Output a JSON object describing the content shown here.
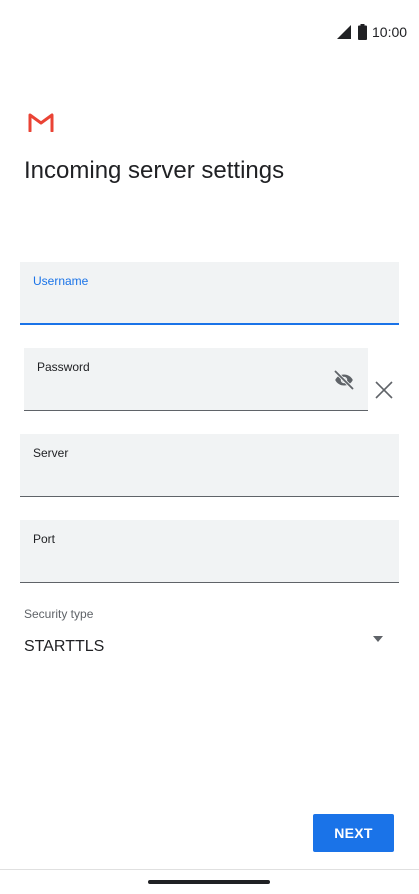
{
  "status_bar": {
    "time": "10:00",
    "signal_icon": "cell-signal-icon",
    "battery_icon": "battery-icon"
  },
  "header": {
    "logo_icon": "gmail-logo-icon",
    "title": "Incoming server settings"
  },
  "form": {
    "username": {
      "label": "Username",
      "value": "",
      "active": true
    },
    "password": {
      "label": "Password",
      "value": "",
      "visibility_icon": "visibility-off-icon",
      "clear_icon": "close-icon"
    },
    "server": {
      "label": "Server",
      "value": ""
    },
    "port": {
      "label": "Port",
      "value": ""
    },
    "security_type": {
      "label": "Security type",
      "value": "STARTTLS",
      "arrow_icon": "dropdown-arrow-icon"
    }
  },
  "actions": {
    "next_label": "NEXT"
  },
  "colors": {
    "accent": "#1a73e8",
    "field_background": "#f1f3f4",
    "gmail_red": "#ea4335"
  }
}
